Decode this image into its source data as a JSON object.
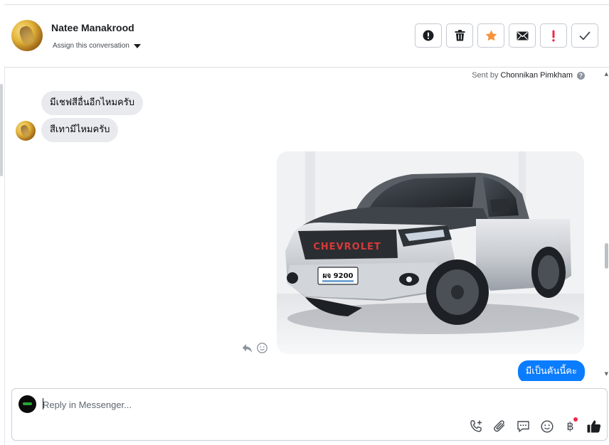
{
  "header": {
    "contact_name": "Natee Manakrood",
    "assign_label": "Assign this conversation",
    "actions": [
      {
        "name": "spam-button",
        "icon": "alert-circle-icon"
      },
      {
        "name": "delete-button",
        "icon": "trash-icon"
      },
      {
        "name": "star-button",
        "icon": "star-icon"
      },
      {
        "name": "mark-unread-button",
        "icon": "envelope-icon"
      },
      {
        "name": "follow-up-button",
        "icon": "exclamation-icon"
      },
      {
        "name": "done-button",
        "icon": "check-icon"
      }
    ]
  },
  "conversation": {
    "sent_by_prefix": "Sent by",
    "sent_by_name": "Chonnikan Pimkham",
    "messages": [
      {
        "direction": "incoming",
        "text": "มีเชฟสีอื่นอีกไหมครับ"
      },
      {
        "direction": "incoming",
        "text": "สีเทามีไหมครับ"
      },
      {
        "direction": "outgoing",
        "type": "image",
        "subject": "silver-pickup-truck-photo",
        "plate_text": "ผจ 9200",
        "grille_text": "CHEVROLET"
      },
      {
        "direction": "outgoing",
        "text": "มีเป็นคันนี้คะ"
      }
    ]
  },
  "composer": {
    "placeholder": "Reply in Messenger...",
    "tools": [
      "phone-add-icon",
      "paperclip-icon",
      "chat-bubble-icon",
      "emoji-icon",
      "baht-icon",
      "thumbs-up-icon"
    ],
    "baht_symbol": "฿"
  },
  "colors": {
    "accent_blue": "#0a7cff",
    "star_orange": "#f7923a",
    "alert_red": "#f02849",
    "bubble_gray": "#e9eaed"
  }
}
